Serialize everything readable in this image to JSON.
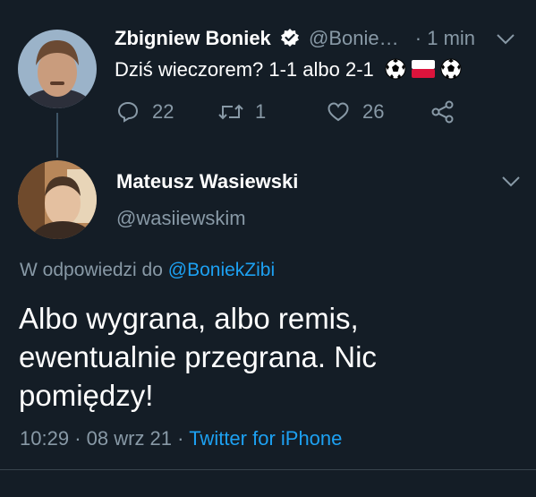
{
  "tweet1": {
    "name": "Zbigniew Boniek",
    "handle": "@Bonie…",
    "time": "· 1 min",
    "text": "Dziś wieczorem? 1-1 albo 2-1",
    "replies": "22",
    "retweets": "1",
    "likes": "26"
  },
  "tweet2": {
    "name": "Mateusz Wasiewski",
    "handle": "@wasiiewskim",
    "reply_prefix": "W odpowiedzi do",
    "reply_to": "@BoniekZibi",
    "text_lines": [
      "Albo wygrana, albo remis,",
      "ewentualnie przegrana. Nic",
      "pomiędzy!"
    ],
    "time": "10:29",
    "date": "08 wrz 21",
    "source": "Twitter for iPhone"
  },
  "colors": {
    "background": "#141d26",
    "muted": "#8899a6",
    "link": "#1da1f2"
  }
}
